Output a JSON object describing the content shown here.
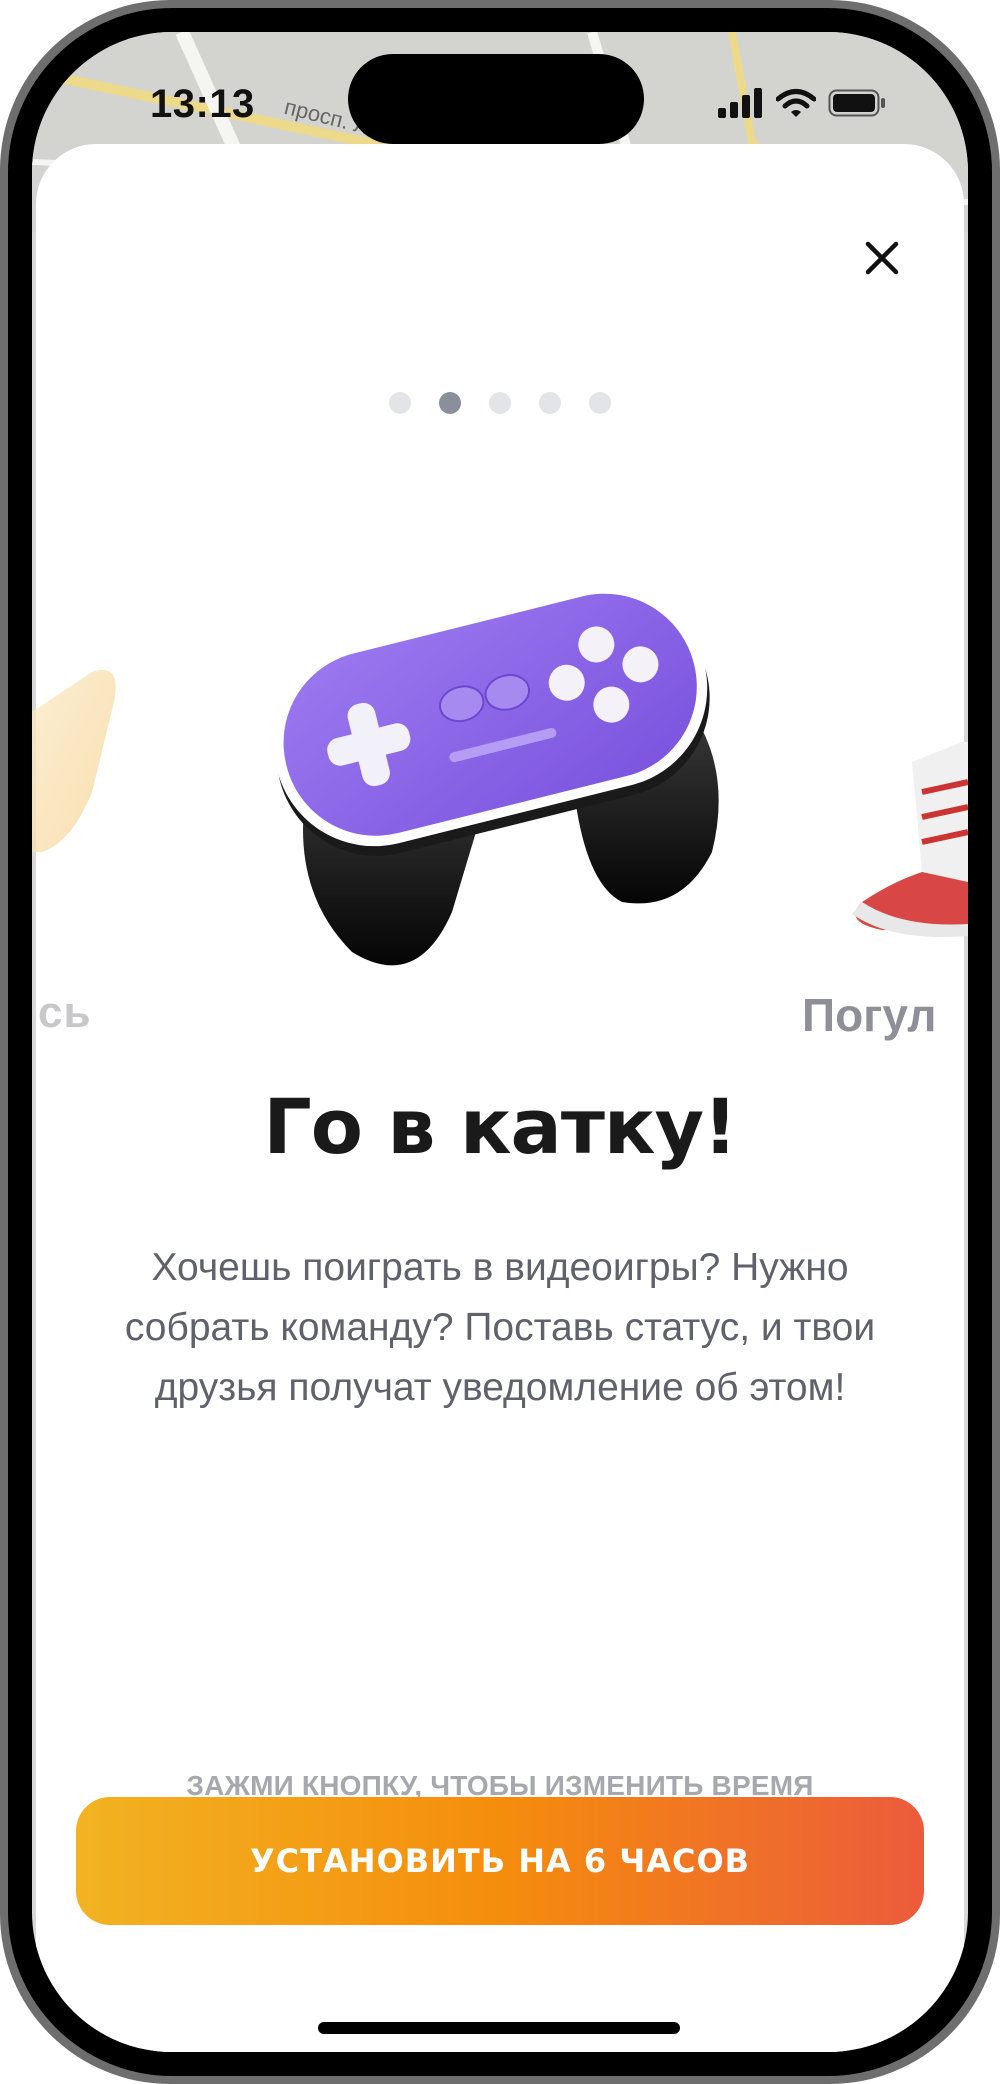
{
  "status_bar": {
    "time": "13:13",
    "icons": [
      "cellular-signal-icon",
      "wifi-icon",
      "battery-icon"
    ]
  },
  "map": {
    "street_label": "просп. Л"
  },
  "sheet": {
    "close_icon": "close-icon",
    "pager": {
      "total": 5,
      "active_index": 1
    },
    "carousel": {
      "prev_label_fragment": "сь",
      "current_icon": "gamepad-icon",
      "next_label_fragment": "Погул"
    },
    "title": "Го в катку!",
    "description": "Хочешь поиграть в видеоигры? Нужно собрать команду? Поставь статус, и твои друзья получат уведомление об этом!",
    "hint": "ЗАЖМИ КНОПКУ, ЧТОБЫ ИЗМЕНИТЬ ВРЕМЯ",
    "cta_label": "УСТАНОВИТЬ НА 6 ЧАСОВ"
  },
  "colors": {
    "accent_start": "#f2b322",
    "accent_mid": "#f58d0c",
    "accent_end": "#ec5b3c",
    "gamepad_purple": "#8a63e8",
    "pager_active": "#8a8f9c",
    "pager_inactive": "#e3e4e8"
  }
}
